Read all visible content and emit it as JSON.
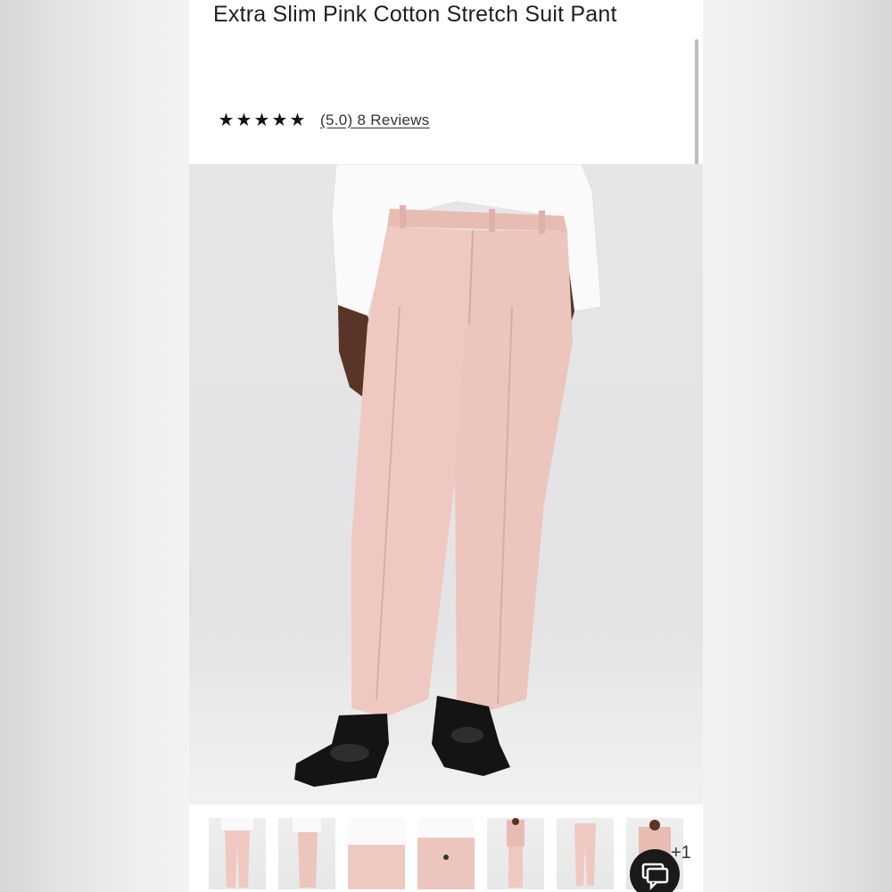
{
  "product": {
    "title": "Extra Slim Pink Cotton Stretch Suit Pant",
    "rating_stars": 5,
    "rating_text": "(5.0) 8 Reviews"
  },
  "colors": {
    "pant": "#efc9c1",
    "pant_shadow": "#dcb0a7",
    "shirt": "#fafafa",
    "skin": "#5a3426",
    "shoe": "#141414",
    "background": "#e5e5e7"
  },
  "gallery": {
    "thumbnails": [
      "front-view",
      "side-view",
      "waist-closeup",
      "pocket-detail",
      "full-suit",
      "flat-lay",
      "suit-jacket"
    ],
    "more_count": "+1"
  },
  "icons": {
    "star": "★",
    "chat": "chat-icon"
  }
}
